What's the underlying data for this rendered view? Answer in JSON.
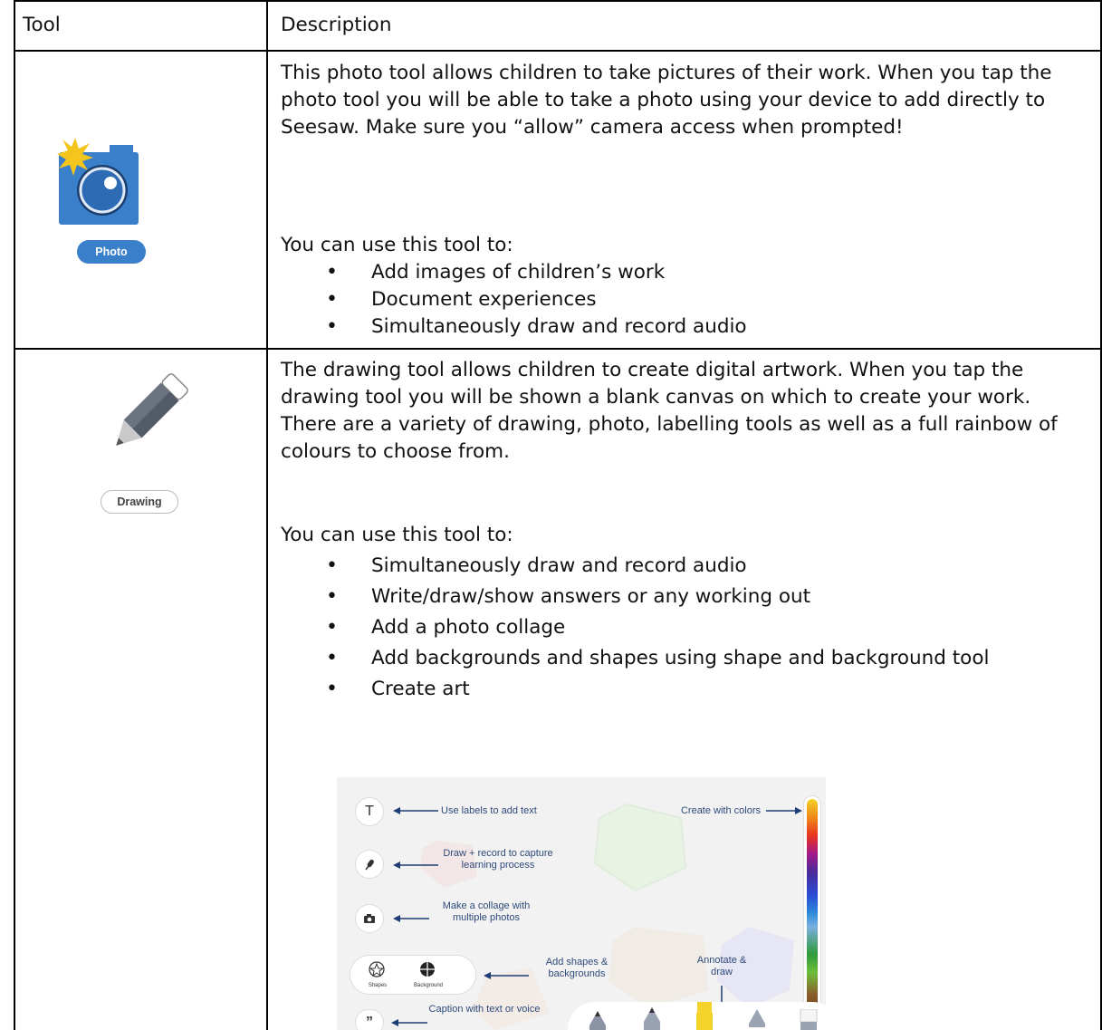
{
  "table": {
    "headers": {
      "tool": "Tool",
      "description": "Description"
    },
    "rows": [
      {
        "tool_label": "Photo",
        "icon": "camera-icon",
        "description": "This photo tool allows children to take pictures of their work. When you tap the photo tool you will be able to take a photo using your device to add directly to Seesaw. Make sure you “allow” camera access when prompted!",
        "uses_intro": "You can use this tool to:",
        "uses": [
          "Add images of children’s work",
          "Document experiences",
          "Simultaneously draw and record audio"
        ]
      },
      {
        "tool_label": "Drawing",
        "icon": "pencil-icon",
        "description": "The drawing tool allows children to create digital artwork. When you tap the drawing tool you will be shown a blank canvas on which to create your work. There are a variety of drawing, photo, labelling tools as well as a full rainbow of colours to choose from.",
        "uses_intro": "You can use this tool to:",
        "uses": [
          "Simultaneously draw and record audio",
          "Write/draw/show answers or any working out",
          "Add a photo collage",
          "Add backgrounds and shapes using shape and background tool",
          "Create art"
        ]
      }
    ]
  },
  "screenshot": {
    "labels": {
      "text": "Use labels to add text",
      "draw_record": "Draw + record to capture learning process",
      "collage": "Make a collage with multiple photos",
      "shapes": "Add shapes & backgrounds",
      "annotate": "Annotate & draw",
      "caption": "Caption with text or voice",
      "colors": "Create with colors"
    },
    "buttons": {
      "text": "T",
      "shapes": "Shapes",
      "background": "Background",
      "caption": "”"
    },
    "accent_colors": {
      "photo_blue": "#3a7fc9",
      "label_blue": "#2e4a7a",
      "pencil_yellow": "#f3d22a"
    }
  }
}
